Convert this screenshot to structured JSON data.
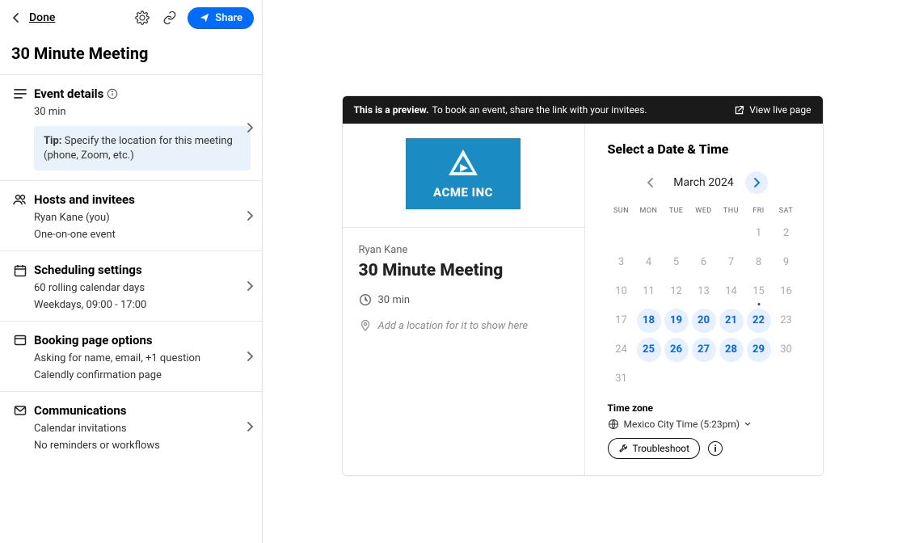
{
  "topbar": {
    "done": "Done",
    "share": "Share"
  },
  "title": "30 Minute Meeting",
  "sections": {
    "event": {
      "title": "Event details",
      "duration": "30 min",
      "tip_label": "Tip:",
      "tip_text": "Specify the location for this meeting (phone, Zoom, etc.)"
    },
    "hosts": {
      "title": "Hosts and invitees",
      "line1": "Ryan Kane (you)",
      "line2": "One-on-one event"
    },
    "scheduling": {
      "title": "Scheduling settings",
      "line1": "60 rolling calendar days",
      "line2": "Weekdays, 09:00 - 17:00"
    },
    "booking": {
      "title": "Booking page options",
      "line1": "Asking for name, email, +1 question",
      "line2": "Calendly confirmation page"
    },
    "comms": {
      "title": "Communications",
      "line1": "Calendar invitations",
      "line2": "No reminders or workflows"
    }
  },
  "preview": {
    "bar_bold": "This is a preview.",
    "bar_text": "To book an event, share the link with your invitees.",
    "view_live": "View live page",
    "logo_text": "ACME INC",
    "host": "Ryan Kane",
    "event_title": "30 Minute Meeting",
    "duration": "30 min",
    "location_placeholder": "Add a location for it to show here",
    "select_heading": "Select a Date & Time",
    "month": "March 2024",
    "dow": [
      "SUN",
      "MON",
      "TUE",
      "WED",
      "THU",
      "FRI",
      "SAT"
    ],
    "tz_label": "Time zone",
    "tz_value": "Mexico City Time (5:23pm)",
    "troubleshoot": "Troubleshoot"
  },
  "calendar": {
    "leading_empty": 5,
    "days": [
      {
        "n": 1,
        "cls": "muted"
      },
      {
        "n": 2,
        "cls": "muted"
      },
      {
        "n": 3,
        "cls": "muted"
      },
      {
        "n": 4,
        "cls": "muted"
      },
      {
        "n": 5,
        "cls": "muted"
      },
      {
        "n": 6,
        "cls": "muted"
      },
      {
        "n": 7,
        "cls": "muted"
      },
      {
        "n": 8,
        "cls": "muted"
      },
      {
        "n": 9,
        "cls": "muted"
      },
      {
        "n": 10,
        "cls": "muted"
      },
      {
        "n": 11,
        "cls": "muted"
      },
      {
        "n": 12,
        "cls": "muted"
      },
      {
        "n": 13,
        "cls": "muted"
      },
      {
        "n": 14,
        "cls": "muted"
      },
      {
        "n": 15,
        "cls": "muted today-dot"
      },
      {
        "n": 16,
        "cls": "muted"
      },
      {
        "n": 17,
        "cls": "muted"
      },
      {
        "n": 18,
        "cls": "avail"
      },
      {
        "n": 19,
        "cls": "avail"
      },
      {
        "n": 20,
        "cls": "avail"
      },
      {
        "n": 21,
        "cls": "avail"
      },
      {
        "n": 22,
        "cls": "avail"
      },
      {
        "n": 23,
        "cls": "muted"
      },
      {
        "n": 24,
        "cls": "muted"
      },
      {
        "n": 25,
        "cls": "avail"
      },
      {
        "n": 26,
        "cls": "avail"
      },
      {
        "n": 27,
        "cls": "avail"
      },
      {
        "n": 28,
        "cls": "avail"
      },
      {
        "n": 29,
        "cls": "avail"
      },
      {
        "n": 30,
        "cls": "muted"
      },
      {
        "n": 31,
        "cls": "muted"
      }
    ]
  }
}
